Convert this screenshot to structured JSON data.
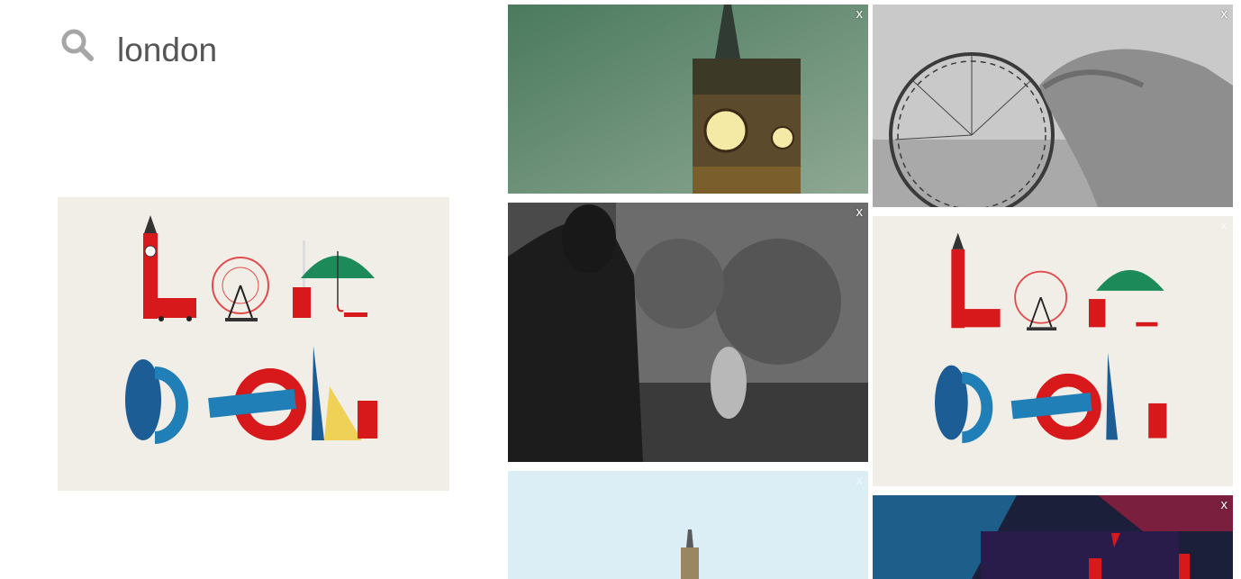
{
  "search": {
    "query": "london",
    "icon": "search-icon"
  },
  "results": {
    "close_label": "x"
  },
  "colors": {
    "search_gray": "#a6a6a6",
    "preview_bg": "#f0eee7",
    "london_red": "#d7191c",
    "london_blue": "#1f7fb6",
    "umbrella_green": "#1d8a5a"
  }
}
